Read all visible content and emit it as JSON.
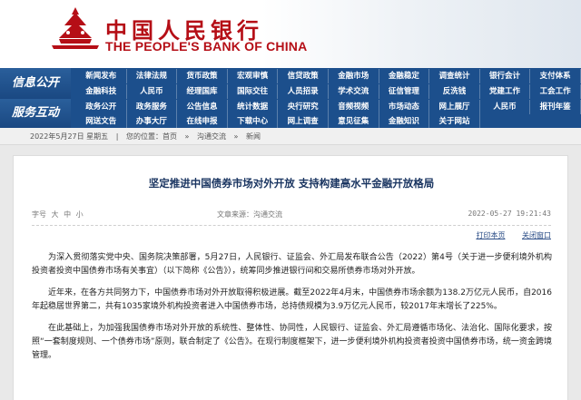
{
  "header": {
    "title_cn": "中国人民银行",
    "title_en": "THE PEOPLE'S BANK OF CHINA"
  },
  "nav": {
    "section1": "信息公开",
    "section2": "服务互动",
    "rows": [
      [
        "新闻发布",
        "法律法规",
        "货币政策",
        "宏观审慎",
        "信贷政策",
        "金融市场",
        "金融稳定",
        "调查统计",
        "银行会计",
        "支付体系"
      ],
      [
        "金融科技",
        "人民币",
        "经理国库",
        "国际交往",
        "人员招录",
        "学术交流",
        "征信管理",
        "反洗钱",
        "党建工作",
        "工会工作"
      ],
      [
        "政务公开",
        "政务服务",
        "公告信息",
        "统计数据",
        "央行研究",
        "音频视频",
        "市场动态",
        "网上展厅",
        "人民币",
        "报刊年鉴"
      ],
      [
        "网送文告",
        "办事大厅",
        "在线申报",
        "下载中心",
        "网上调查",
        "意见征集",
        "金融知识",
        "关于网站",
        "",
        ""
      ]
    ]
  },
  "breadcrumb": [
    "2022年5月27日 星期五",
    "|",
    "您的位置：首页",
    "»",
    "沟通交流",
    "»",
    "新闻"
  ],
  "article": {
    "title": "坚定推进中国债券市场对外开放  支持构建高水平金融开放格局",
    "font_size_label": "字号",
    "font_sizes": [
      "大",
      "中",
      "小"
    ],
    "source": "文章来源：沟通交流",
    "datetime": "2022-05-27  19:21:43",
    "print_label": "打印本页",
    "close_label": "关闭窗口",
    "paragraphs": [
      "为深入贯彻落实党中央、国务院决策部署，5月27日，人民银行、证监会、外汇局发布联合公告（2022）第4号（关于进一步便利境外机构投资者投资中国债券市场有关事宜）（以下简称《公告》），统筹同步推进银行间和交易所债券市场对外开放。",
      "近年来，在各方共同努力下，中国债券市场对外开放取得积极进展。截至2022年4月末，中国债券市场余额为138.2万亿元人民币，自2016年起稳居世界第二，共有1035家境外机构投资者进入中国债券市场，总持债规模为3.9万亿元人民币，较2017年末增长了225%。",
      "在此基础上，为加强我国债券市场对外开放的系统性、整体性、协同性，人民银行、证监会、外汇局遵循市场化、法治化、国际化要求，按照“一套制度规则、一个债券市场”原则，联合制定了《公告》。在现行制度框架下，进一步便利境外机构投资者投资中国债券市场，统一资金跨境管理。"
    ]
  }
}
